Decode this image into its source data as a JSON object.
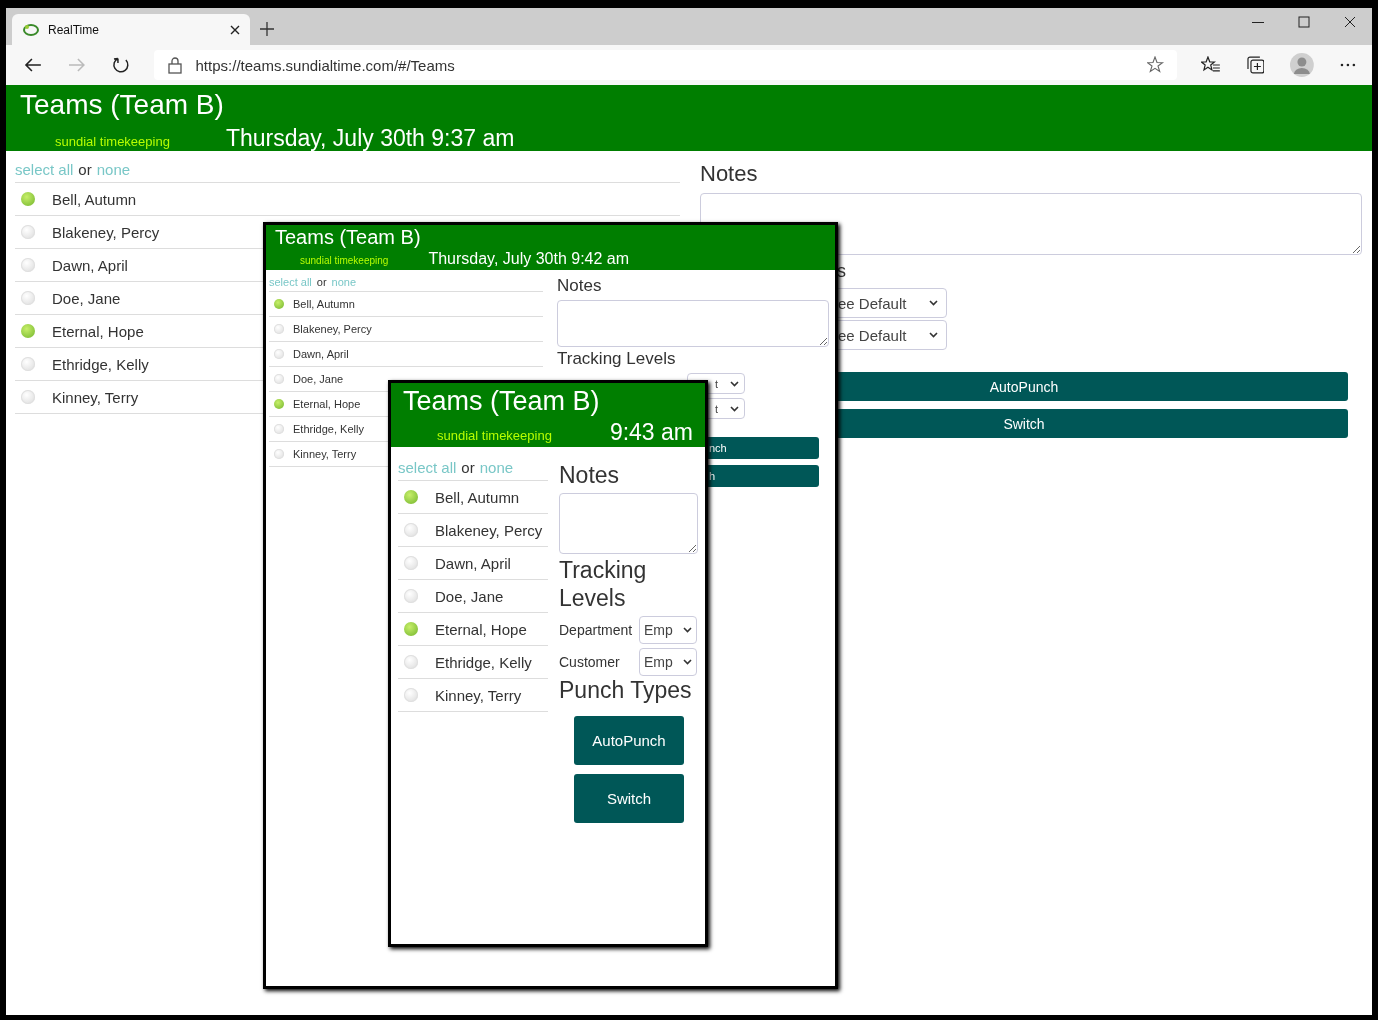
{
  "browser": {
    "tab_title": "RealTime",
    "url": "https://teams.sundialtime.com/#/Teams"
  },
  "views": [
    {
      "title": "Teams (Team B)",
      "tagline": "sundial timekeeping",
      "datetime": "Thursday, July 30th 9:37 am",
      "select_all": "select all",
      "or": "or",
      "none": "none",
      "people": [
        {
          "name": "Bell, Autumn",
          "in": true
        },
        {
          "name": "Blakeney, Percy",
          "in": false
        },
        {
          "name": "Dawn, April",
          "in": false
        },
        {
          "name": "Doe, Jane",
          "in": false
        },
        {
          "name": "Eternal, Hope",
          "in": true
        },
        {
          "name": "Ethridge, Kelly",
          "in": false
        },
        {
          "name": "Kinney, Terry",
          "in": false
        }
      ],
      "notes_label": "Notes",
      "tracking_label": "s",
      "tracking": [
        {
          "value": "ee Default"
        },
        {
          "value": "ee Default"
        }
      ],
      "buttons": [
        "AutoPunch",
        "Switch"
      ]
    },
    {
      "title": "Teams (Team B)",
      "tagline": "sundial timekeeping",
      "datetime": "Thursday, July 30th 9:42 am",
      "select_all": "select all",
      "or": "or",
      "none": "none",
      "people": [
        {
          "name": "Bell, Autumn",
          "in": true
        },
        {
          "name": "Blakeney, Percy",
          "in": false
        },
        {
          "name": "Dawn, April",
          "in": false
        },
        {
          "name": "Doe, Jane",
          "in": false
        },
        {
          "name": "Eternal, Hope",
          "in": true
        },
        {
          "name": "Ethridge, Kelly",
          "in": false
        },
        {
          "name": "Kinney, Terry",
          "in": false
        }
      ],
      "notes_label": "Notes",
      "tracking_label": "Tracking Levels",
      "tracking": [
        {
          "value": "t"
        },
        {
          "value": "t"
        }
      ],
      "buttons": [
        "nch",
        "h"
      ]
    },
    {
      "title": "Teams (Team B)",
      "tagline": "sundial timekeeping",
      "datetime": "9:43 am",
      "select_all": "select all",
      "or": "or",
      "none": "none",
      "people": [
        {
          "name": "Bell, Autumn",
          "in": true
        },
        {
          "name": "Blakeney, Percy",
          "in": false
        },
        {
          "name": "Dawn, April",
          "in": false
        },
        {
          "name": "Doe, Jane",
          "in": false
        },
        {
          "name": "Eternal, Hope",
          "in": true
        },
        {
          "name": "Ethridge, Kelly",
          "in": false
        },
        {
          "name": "Kinney, Terry",
          "in": false
        }
      ],
      "notes_label": "Notes",
      "tracking_label": "Tracking Levels",
      "tracking": [
        {
          "label": "Department",
          "value": "Emp"
        },
        {
          "label": "Customer",
          "value": "Emp"
        }
      ],
      "punch_label": "Punch Types",
      "buttons": [
        "AutoPunch",
        "Switch"
      ]
    }
  ]
}
